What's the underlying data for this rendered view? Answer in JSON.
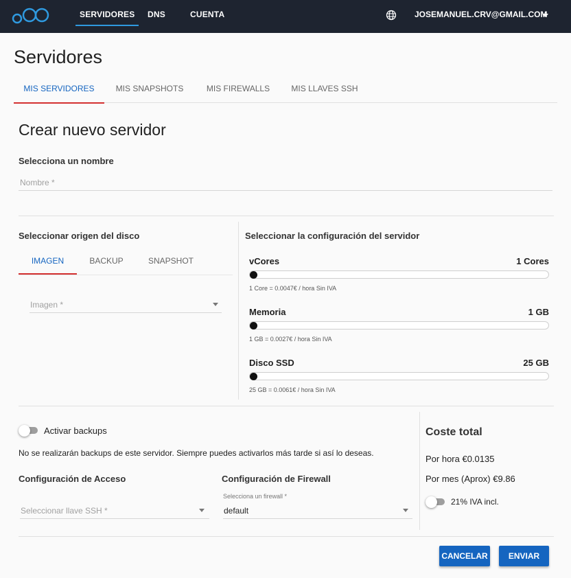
{
  "nav": {
    "items": [
      "SERVIDORES",
      "DNS",
      "CUENTA"
    ],
    "user": "JOSEMANUEL.CRV@GMAIL.COM"
  },
  "page": {
    "title": "Servidores",
    "tabs": [
      "MIS SERVIDORES",
      "MIS SNAPSHOTS",
      "MIS FIREWALLS",
      "MIS LLAVES SSH"
    ]
  },
  "create": {
    "heading": "Crear nuevo servidor",
    "name_label": "Selecciona un nombre",
    "name_placeholder": "Nombre *",
    "disk_label": "Seleccionar origen del disco",
    "disk_tabs": [
      "IMAGEN",
      "BACKUP",
      "SNAPSHOT"
    ],
    "image_placeholder": "Imagen *",
    "config_label": "Seleccionar la configuración del servidor",
    "sliders": [
      {
        "label": "vCores",
        "value": "1 Cores",
        "note": "1 Core = 0.0047€ / hora Sin IVA",
        "level": 0
      },
      {
        "label": "Memoria",
        "value": "1 GB",
        "note": "1 GB = 0.0027€ / hora Sin IVA",
        "level": 0
      },
      {
        "label": "Disco SSD",
        "value": "25 GB",
        "note": "25 GB = 0.0061€ / hora Sin IVA",
        "level": 0
      }
    ]
  },
  "backups": {
    "toggle_label": "Activar backups",
    "enabled": false,
    "note": "No se realizarán backups de este servidor. Siempre puedes activarlos más tarde si así lo deseas."
  },
  "access": {
    "label": "Configuración de Acceso",
    "ssh_placeholder": "Seleccionar llave SSH *"
  },
  "firewall": {
    "label": "Configuración de Firewall",
    "field_label": "Selecciona un firewall *",
    "value": "default"
  },
  "cost": {
    "title": "Coste total",
    "per_hour": "Por hora €0.0135",
    "per_month": "Por mes (Aprox) €9.86",
    "vat_label": "21% IVA incl.",
    "vat_enabled": false
  },
  "actions": {
    "cancel": "CANCELAR",
    "send": "ENVIAR"
  },
  "colors": {
    "topbar": "#1e2430",
    "accent": "#1565c0",
    "tab_indicator": "#d32f2f"
  }
}
